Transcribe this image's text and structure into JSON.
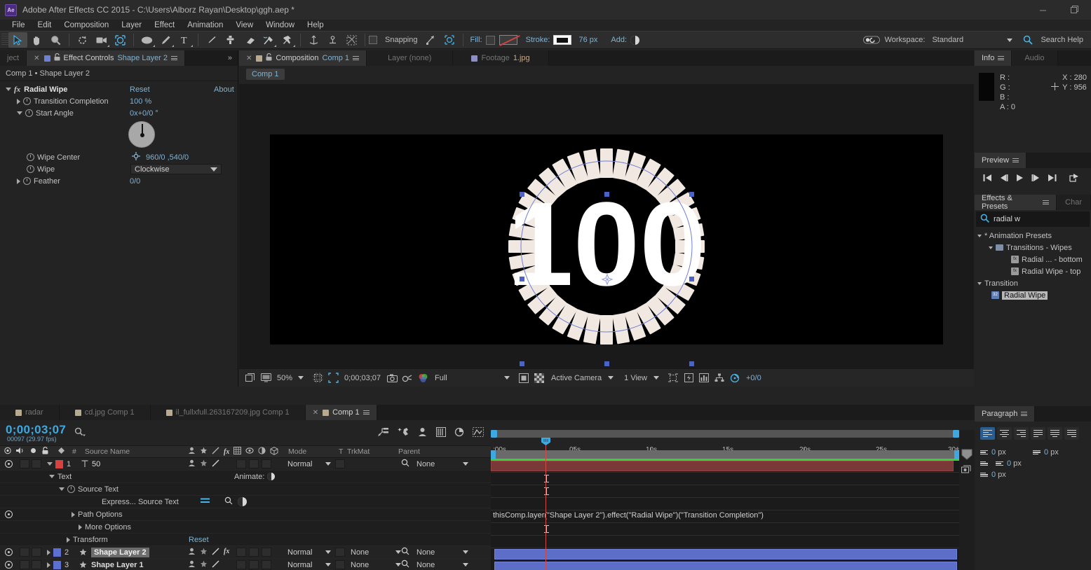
{
  "titlebar": {
    "logo": "Ae",
    "title": "Adobe After Effects CC 2015 - C:\\Users\\Alborz Rayan\\Desktop\\ggh.aep *",
    "minimize": "minimize-icon",
    "restore": "restore-icon"
  },
  "menubar": {
    "items": [
      "File",
      "Edit",
      "Composition",
      "Layer",
      "Effect",
      "Animation",
      "View",
      "Window",
      "Help"
    ]
  },
  "toolbar": {
    "tools": [
      "selection-tool",
      "hand-tool",
      "zoom-tool",
      "rotation-tool",
      "camera-tool",
      "pan-behind-tool",
      "shape-tool",
      "pen-tool",
      "text-tool",
      "brush-tool",
      "clone-stamp-tool",
      "eraser-tool",
      "roto-brush-tool",
      "puppet-pin-tool"
    ],
    "align_tools": [
      "anchor-point-tool",
      "center-anchor-tool",
      "mask-tool"
    ],
    "snapping_label": "Snapping",
    "fill_label": "Fill:",
    "stroke_label": "Stroke:",
    "stroke_width": "76 px",
    "add_label": "Add:",
    "workspace_label": "Workspace:",
    "workspace_value": "Standard",
    "search_help": "Search Help"
  },
  "effect_controls": {
    "tabs": [
      {
        "label": "ject",
        "active": false
      },
      {
        "label": "Effect Controls",
        "highlight": "Shape Layer 2",
        "active": true
      }
    ],
    "subtitle": "Comp 1 • Shape Layer 2",
    "effect_name": "Radial Wipe",
    "reset": "Reset",
    "about": "About",
    "properties": [
      {
        "name": "Transition Completion",
        "value": "100 %"
      },
      {
        "name": "Start Angle",
        "value": "0x+0/0 °"
      },
      {
        "name": "Wipe Center",
        "value": "960/0 ,540/0"
      },
      {
        "name": "Wipe",
        "value": "Clockwise"
      },
      {
        "name": "Feather",
        "value": "0/0"
      }
    ]
  },
  "composition": {
    "tabs": [
      {
        "label": "Composition",
        "highlight": "Comp 1",
        "active": true
      },
      {
        "label": "Layer (none)",
        "active": false
      },
      {
        "label": "Footage",
        "highlight": "1.jpg",
        "active": false
      }
    ],
    "breadcrumb": "Comp 1",
    "canvas_text": "100",
    "bottom_bar": {
      "magnification": "50%",
      "timecode": "0;00;03;07",
      "resolution": "Full",
      "view_camera": "Active Camera",
      "views": "1 View",
      "offset": "+0/0"
    }
  },
  "info": {
    "tabs": [
      "Info",
      "Audio"
    ],
    "r_label": "R :",
    "g_label": "G :",
    "b_label": "B :",
    "a_label": "A : 0",
    "x_label": "X : 280",
    "y_label": "Y : 956"
  },
  "preview": {
    "title": "Preview",
    "buttons": [
      "first-frame-icon",
      "prev-frame-icon",
      "play-icon",
      "next-frame-icon",
      "last-frame-icon",
      "share-icon"
    ]
  },
  "effects_presets": {
    "title": "Effects & Presets",
    "side_tab": "Char",
    "search_value": "radial w",
    "tree": [
      {
        "label": "* Animation Presets",
        "depth": 0,
        "type": "group"
      },
      {
        "label": "Transitions - Wipes",
        "depth": 1,
        "type": "folder"
      },
      {
        "label": "Radial ... - bottom",
        "depth": 2,
        "type": "preset"
      },
      {
        "label": "Radial Wipe - top",
        "depth": 2,
        "type": "preset"
      },
      {
        "label": "Transition",
        "depth": 0,
        "type": "group"
      },
      {
        "label": "Radial Wipe",
        "depth": 1,
        "type": "effect",
        "selected": true
      }
    ]
  },
  "paragraph": {
    "title": "Paragraph",
    "align_buttons": [
      "align-left",
      "align-center",
      "align-right",
      "justify-last-left",
      "justify-last-center",
      "justify-last-right"
    ],
    "fields": [
      {
        "name": "indent-left",
        "value": "0",
        "unit": "px"
      },
      {
        "name": "space-before",
        "value": "0",
        "unit": "px"
      },
      {
        "name": "indent-first-line",
        "value": "",
        "unit": ""
      },
      {
        "name": "indent-right",
        "value": "0",
        "unit": "px"
      },
      {
        "name": "space-after",
        "value": "0",
        "unit": "px"
      }
    ]
  },
  "timeline": {
    "tabs": [
      {
        "label": "radar",
        "active": false
      },
      {
        "label": "cd.jpg Comp 1",
        "active": false
      },
      {
        "label": "il_fullxfull.263167209.jpg Comp 1",
        "active": false
      },
      {
        "label": "Comp 1",
        "active": true
      }
    ],
    "timecode": "0;00;03;07",
    "frame_info": "00097 (29.97 fps)",
    "columns": [
      "#",
      "Source Name",
      "Mode",
      "T",
      "TrkMat",
      "Parent"
    ],
    "switch_icons": [
      "shy-icon",
      "collapse-icon",
      "quality-icon",
      "fx-icon",
      "frame-blend-icon",
      "motion-blur-icon",
      "adjustment-icon",
      "3d-layer-icon"
    ],
    "ruler_labels": [
      ":00s",
      "05s",
      "10s",
      "15s",
      "20s",
      "25s",
      "30s"
    ],
    "rows": [
      {
        "num": "1",
        "name": "50",
        "type": "text",
        "mode": "Normal",
        "parent": "None",
        "color": "#d94141",
        "selected": false
      },
      {
        "num": "",
        "name": "Text",
        "type": "group",
        "indent": 2,
        "extra": "Animate:"
      },
      {
        "num": "",
        "name": "Source Text",
        "type": "prop",
        "indent": 3
      },
      {
        "num": "",
        "name": "Express... Source Text",
        "type": "expr",
        "indent": 4
      },
      {
        "num": "",
        "name": "Path Options",
        "type": "group",
        "indent": 3
      },
      {
        "num": "",
        "name": "More Options",
        "type": "group",
        "indent": 3
      },
      {
        "num": "",
        "name": "Transform",
        "type": "group",
        "indent": 2,
        "reset": "Reset"
      },
      {
        "num": "2",
        "name": "Shape Layer 2",
        "type": "shape",
        "mode": "Normal",
        "trkmat": "None",
        "parent": "None",
        "color": "#5d6fd0",
        "selected": true
      },
      {
        "num": "3",
        "name": "Shape Layer 1",
        "type": "shape",
        "mode": "Normal",
        "trkmat": "None",
        "parent": "None",
        "color": "#5d6fd0",
        "selected": false
      }
    ],
    "expression": "thisComp.layer(\"Shape Layer 2\").effect(\"Radial Wipe\")(\"Transition Completion\")"
  },
  "colors": {
    "accent_blue": "#7fb3d5",
    "timecode_blue": "#3ea9e0",
    "playhead_red": "#d24a43",
    "selection_blue": "#4a63c8",
    "tick_cream": "#f2e8e2"
  }
}
